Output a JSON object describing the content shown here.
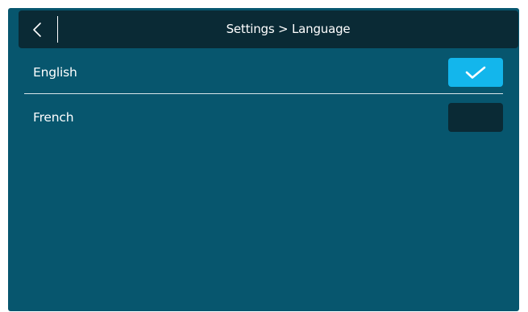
{
  "header": {
    "title": "Settings > Language",
    "back_icon": "chevron-left-icon"
  },
  "languages": [
    {
      "label": "English",
      "selected": true
    },
    {
      "label": "French",
      "selected": false
    }
  ],
  "colors": {
    "background": "#07566e",
    "header": "#0a2a35",
    "checkbox_selected": "#13b6ec",
    "checkbox_unselected": "#0a2a35",
    "text": "#ffffff"
  }
}
